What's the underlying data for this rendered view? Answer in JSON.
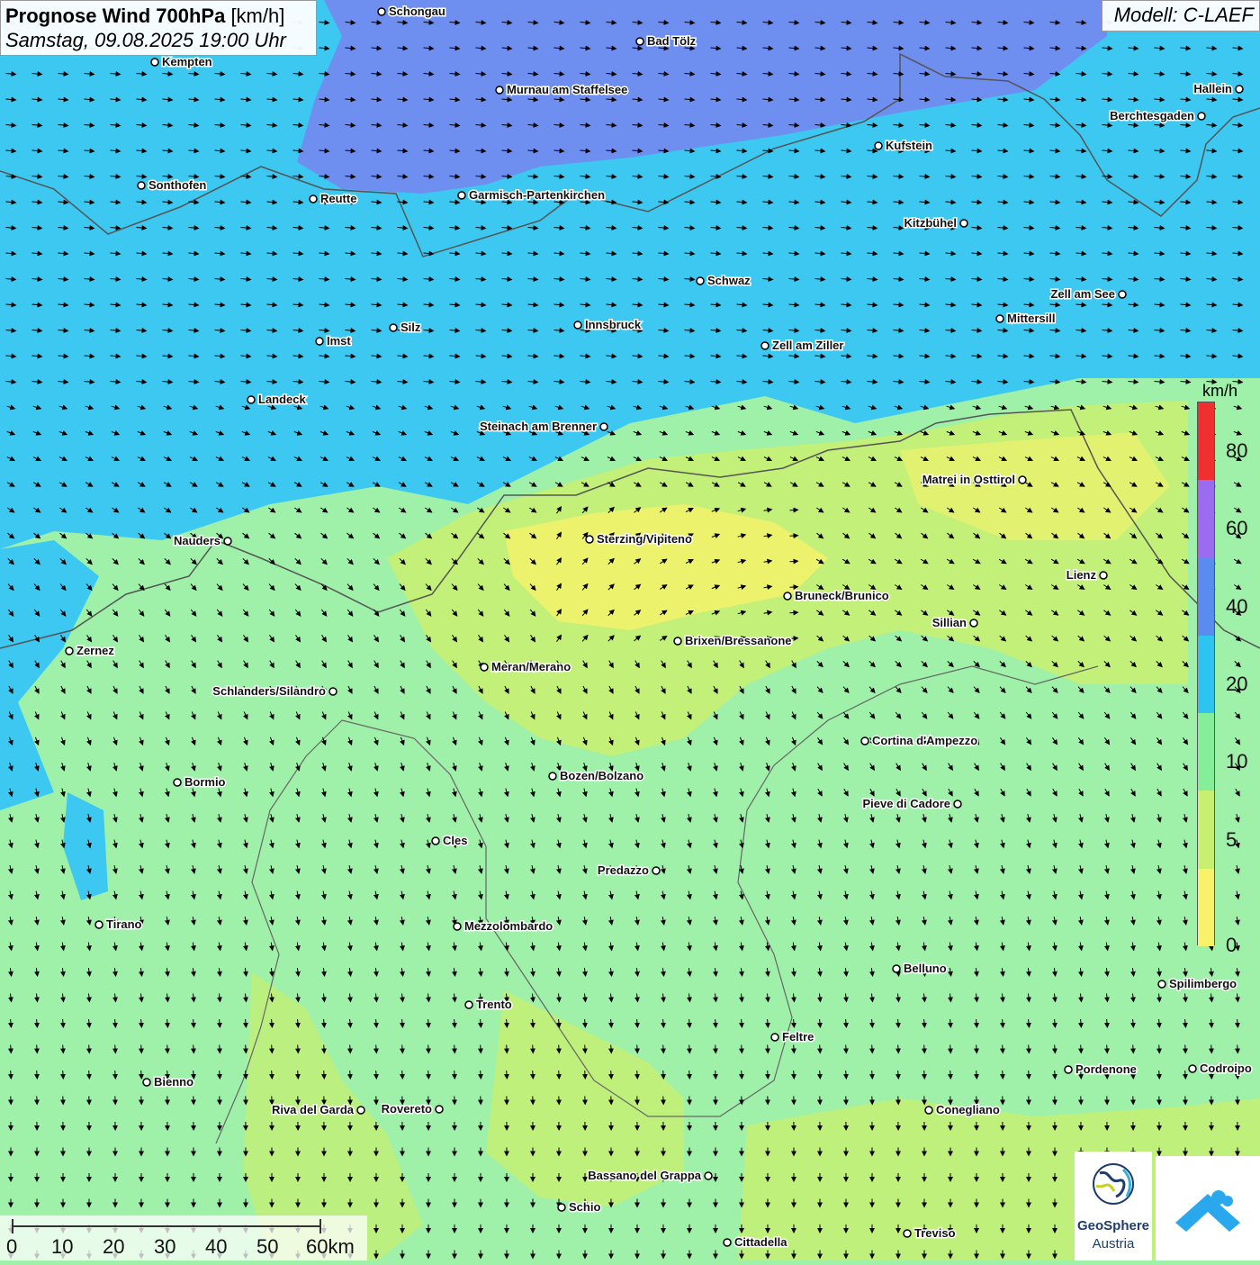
{
  "header": {
    "title_bold": "Prognose Wind 700hPa",
    "title_unit": "[km/h]",
    "datetime": "Samstag, 09.08.2025 19:00 Uhr",
    "model": "Modell: C-LAEF"
  },
  "legend": {
    "unit": "km/h",
    "ticks": [
      "80",
      "60",
      "40",
      "20",
      "10",
      "5",
      "0"
    ],
    "colors": [
      "#f03030",
      "#9c6cf0",
      "#5a8cf0",
      "#2ec4f0",
      "#84ee98",
      "#c8f070",
      "#f7f26a"
    ]
  },
  "scalebar": {
    "labels": [
      "0",
      "10",
      "20",
      "30",
      "40",
      "50",
      "60km"
    ]
  },
  "logos": {
    "geosphere_name": "GeoSphere",
    "geosphere_sub": "Austria"
  },
  "cities": [
    "Schongau",
    "Bad Tölz",
    "Kempten",
    "Murnau am Staffelsee",
    "Hallein",
    "Berchtesgaden",
    "Kufstein",
    "Sonthofen",
    "Reutte",
    "Garmisch-Partenkirchen",
    "Kitzbühel",
    "Schwaz",
    "Zell am See",
    "Mittersill",
    "Innsbruck",
    "Imst",
    "Silz",
    "Zell am Ziller",
    "Landeck",
    "Steinach am Brenner",
    "Matrei in Osttirol",
    "Nauders",
    "Sterzing/Vipiteno",
    "Lienz",
    "Bruneck/Brunico",
    "Sillian",
    "Brixen/Bressanone",
    "Zernez",
    "Meran/Merano",
    "Schlanders/Silandro",
    "Cortina d'Ampezzo",
    "Bormio",
    "Bozen/Bolzano",
    "Pieve di Cadore",
    "Cles",
    "Predazzo",
    "Tirano",
    "Mezzolombardo",
    "Belluno",
    "Spilimbergo",
    "Trento",
    "Feltre",
    "Pordenone",
    "Codroipo",
    "Bienno",
    "Riva del Garda",
    "Rovereto",
    "Conegliano",
    "Bassano del Grappa",
    "Schio",
    "Treviso",
    "Cittadella"
  ],
  "colors": {
    "low_wind": "#f7f26a",
    "light_green": "#c8f070",
    "green": "#9ff0a8",
    "cyan": "#3cc8f0",
    "blue": "#6f8ff0"
  }
}
